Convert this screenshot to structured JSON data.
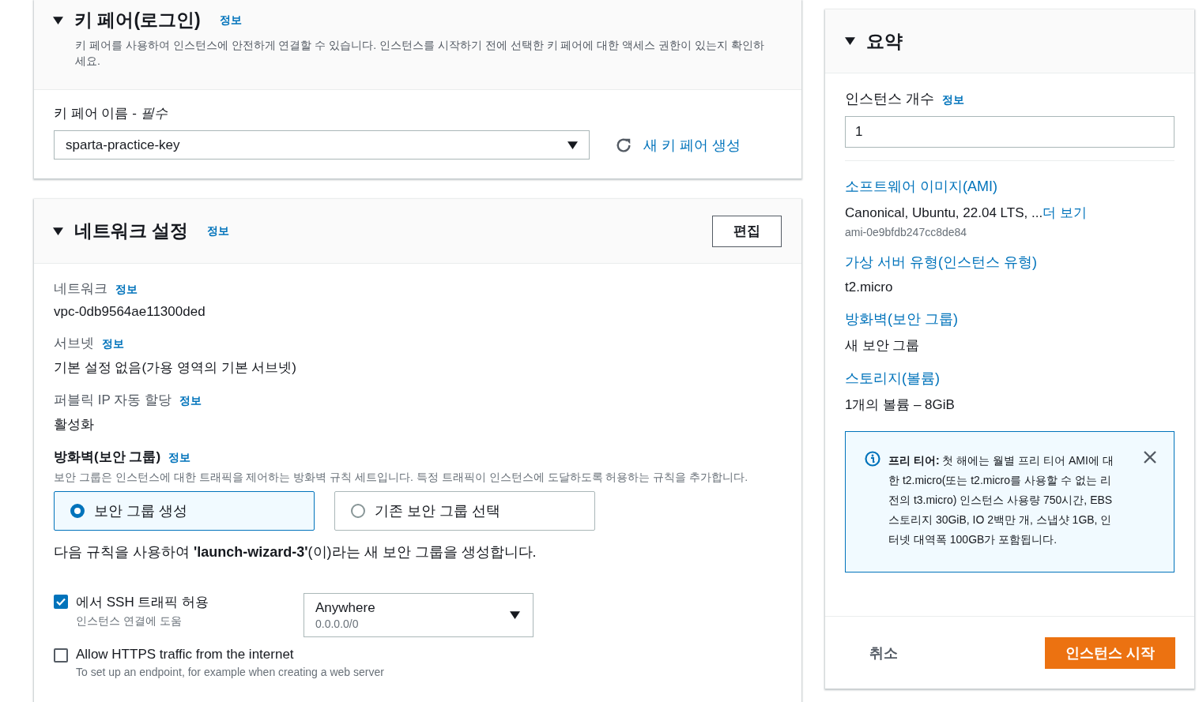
{
  "key_pair": {
    "title": "키 페어(로그인)",
    "info": "정보",
    "description": "키 페어를 사용하여 인스턴스에 안전하게 연결할 수 있습니다. 인스턴스를 시작하기 전에 선택한 키 페어에 대한 액세스 권한이 있는지 확인하세요.",
    "field_label": "키 페어 이름 -",
    "field_required": "필수",
    "value": "sparta-practice-key",
    "new_link": "새 키 페어 생성"
  },
  "network": {
    "title": "네트워크 설정",
    "info": "정보",
    "edit_button": "편집",
    "fields": [
      {
        "label": "네트워크",
        "info": "정보",
        "value": "vpc-0db9564ae11300ded"
      },
      {
        "label": "서브넷",
        "info": "정보",
        "value": "기본 설정 없음(가용 영역의 기본 서브넷)"
      },
      {
        "label": "퍼블릭 IP 자동 할당",
        "info": "정보",
        "value": "활성화"
      }
    ],
    "firewall": {
      "title": "방화벽(보안 그룹)",
      "info": "정보",
      "description": "보안 그룹은 인스턴스에 대한 트래픽을 제어하는 방화벽 규칙 세트입니다. 특정 트래픽이 인스턴스에 도달하도록 허용하는 규칙을 추가합니다.",
      "options": [
        {
          "label": "보안 그룹 생성",
          "selected": true
        },
        {
          "label": "기존 보안 그룹 선택",
          "selected": false
        }
      ],
      "rule_text": "다음 규칙을 사용하여 **'launch-wizard-3'**(이)라는 새 보안 그룹을 생성합니다.",
      "rules": [
        {
          "label": "에서 SSH 트래픽 허용",
          "hint": "인스턴스 연결에 도움",
          "checked": true,
          "source": {
            "value": "Anywhere",
            "detail": "0.0.0.0/0"
          }
        },
        {
          "label": "Allow HTTPS traffic from the internet",
          "hint": "To set up an endpoint, for example when creating a web server",
          "checked": false
        }
      ]
    }
  },
  "summary": {
    "title": "요약",
    "count_label": "인스턴스 개수",
    "count_info": "정보",
    "count_value": "1",
    "items": [
      {
        "heading": "소프트웨어 이미지(AMI)",
        "value": "Canonical, Ubuntu, 22.04 LTS, ...",
        "more": "더 보기",
        "detail": "ami-0e9bfdb247cc8de84"
      },
      {
        "heading": "가상 서버 유형(인스턴스 유형)",
        "value": "t2.micro"
      },
      {
        "heading": "방화벽(보안 그룹)",
        "value": "새 보안 그룹"
      },
      {
        "heading": "스토리지(볼륨)",
        "value": "1개의 볼륨 – 8GiB"
      }
    ],
    "notice": "**프리 티어:** 첫 해에는 월별 프리 티어 AMI에 대한 t2.micro(또는 t2.micro를 사용할 수 없는 리전의 t3.micro) 인스턴스 사용량 750시간, EBS 스토리지 30GiB, IO 2백만 개, 스냅샷 1GB, 인터넷 대역폭 100GB가 포함됩니다.",
    "cancel": "취소",
    "launch": "인스턴스 시작"
  }
}
